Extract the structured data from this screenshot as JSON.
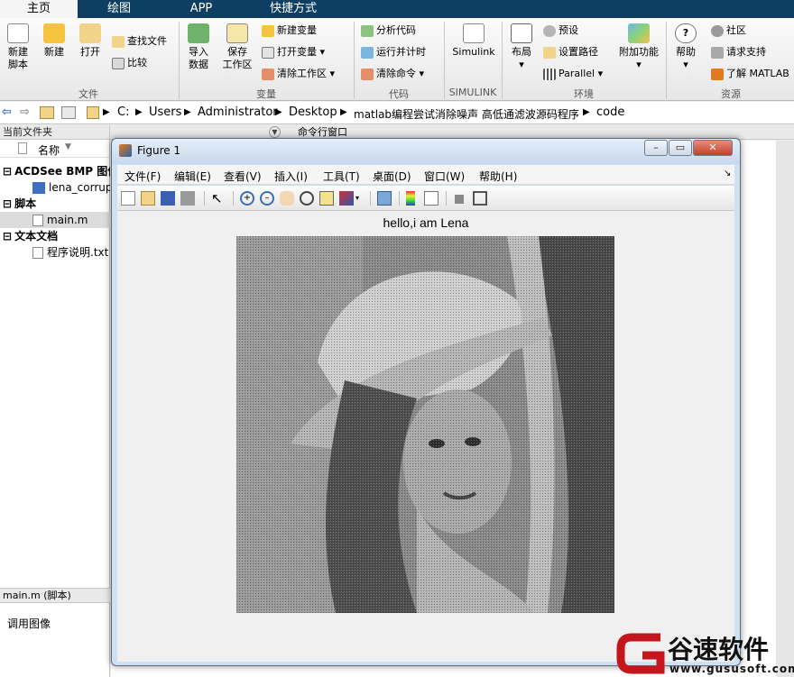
{
  "ribbon_tabs": [
    "主页",
    "绘图",
    "APP",
    "快捷方式"
  ],
  "ribbon": {
    "file": {
      "new_script": "新建\n脚本",
      "new": "新建",
      "open": "打开",
      "find_files": "查找文件",
      "compare": "比较",
      "label": "文件"
    },
    "variable": {
      "import": "导入\n数据",
      "save": "保存\n工作区",
      "new_var": "新建变量",
      "open_var": "打开变量",
      "clear_ws": "清除工作区",
      "label": "变量"
    },
    "code": {
      "analyze": "分析代码",
      "run_time": "运行并计时",
      "clear_cmd": "清除命令",
      "label": "代码"
    },
    "simulink": {
      "btn": "Simulink",
      "label": "SIMULINK"
    },
    "env": {
      "layout": "布局",
      "prefs": "预设",
      "set_path": "设置路径",
      "parallel": "Parallel",
      "addons": "附加功能",
      "label": "环境"
    },
    "resources": {
      "help": "帮助",
      "community": "社区",
      "support": "请求支持",
      "learn": "了解 MATLAB",
      "label": "资源"
    }
  },
  "address": [
    "C:",
    "Users",
    "Administrator",
    "Desktop",
    "matlab编程尝试消除噪声 高低通滤波源码程序",
    "code"
  ],
  "left_panel": {
    "title": "当前文件夹",
    "col_name": "名称",
    "groups": [
      {
        "label": "ACDSee BMP 图像",
        "items": [
          "lena_corrupted"
        ]
      },
      {
        "label": "脚本",
        "items": [
          "main.m"
        ]
      },
      {
        "label": "文本文档",
        "items": [
          "程序说明.txt"
        ]
      }
    ],
    "details_title": "main.m  (脚本)",
    "details_text": "调用图像"
  },
  "command_window": {
    "title": "命令行窗口"
  },
  "figure": {
    "window_title": "Figure 1",
    "menus": [
      "文件(F)",
      "编辑(E)",
      "查看(V)",
      "插入(I)",
      "工具(T)",
      "桌面(D)",
      "窗口(W)",
      "帮助(H)"
    ],
    "plot_title": "hello,i am Lena",
    "toolbar_icons": [
      "new-figure-icon",
      "open-icon",
      "save-icon",
      "print-icon",
      "pointer-icon",
      "zoom-in-icon",
      "zoom-out-icon",
      "pan-icon",
      "rotate-icon",
      "data-cursor-icon",
      "brush-icon",
      "link-icon",
      "colorbar-icon",
      "legend-icon",
      "hide-plot-tools-icon",
      "show-plot-tools-icon"
    ]
  },
  "watermark": {
    "brand": "谷速软件",
    "url": "www.gususoft.com"
  },
  "colors": {
    "ribbon_tab_bar": "#0e3f63",
    "accent": "#c4161c",
    "matlab_orange": "#e07a1f"
  }
}
